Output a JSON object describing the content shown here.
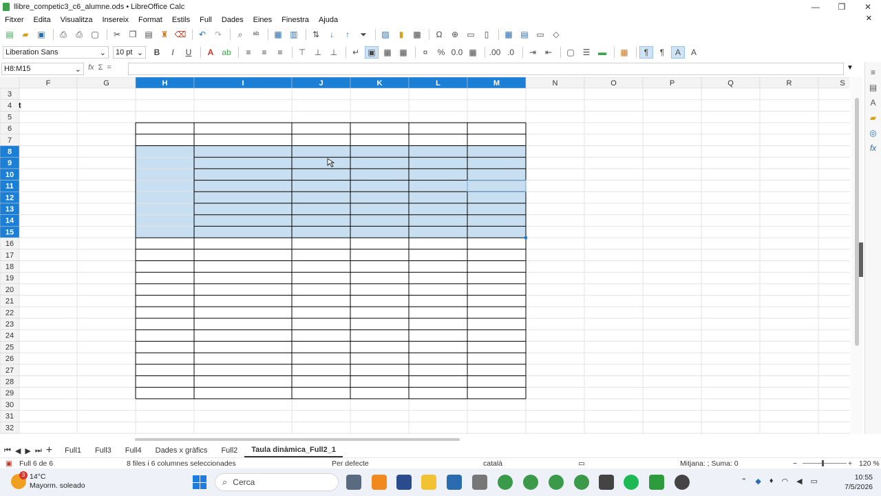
{
  "window": {
    "title": "llibre_competic3_c6_alumne.ods • LibreOffice Calc",
    "minimize": "—",
    "maximize": "❐",
    "close": "✕"
  },
  "menu": [
    "Fitxer",
    "Edita",
    "Visualitza",
    "Insereix",
    "Format",
    "Estils",
    "Full",
    "Dades",
    "Eines",
    "Finestra",
    "Ajuda"
  ],
  "font_box": {
    "name": "Liberation Sans",
    "size": "10 pt"
  },
  "formula_bar": {
    "cell_ref": "H8:M15",
    "value": ""
  },
  "grid": {
    "columns": [
      "F",
      "G",
      "H",
      "I",
      "J",
      "K",
      "L",
      "M",
      "N",
      "O",
      "P",
      "Q",
      "R",
      "S"
    ],
    "selected_columns": [
      "H",
      "I",
      "J",
      "K",
      "L",
      "M"
    ],
    "first_row": 3,
    "last_row": 32,
    "selected_rows": [
      8,
      9,
      10,
      11,
      12,
      13,
      14,
      15
    ],
    "table_rows": [
      6,
      29
    ],
    "cell_F4": "t",
    "colors": {
      "selection": "#c8dff1",
      "header_selected": "#1c7fd6",
      "header": "#f3f3f3",
      "border": "#000000"
    }
  },
  "sheet_tabs": [
    "Full1",
    "Full3",
    "Full4",
    "Dades x gràfics",
    "Full2",
    "Taula dinàmica_Full2_1"
  ],
  "active_tab": "Taula dinàmica_Full2_1",
  "status": {
    "sheet": "Full 6 de 6",
    "selection": "8 files i 6 columnes seleccionades",
    "style": "Per defecte",
    "language": "català",
    "sum": "Mitjana: ; Suma: 0",
    "zoom": "120 %"
  },
  "taskbar": {
    "temperature": "14°C",
    "weather": "Mayorm. soleado",
    "notification_count": "3",
    "search_placeholder": "Cerca",
    "time": "10:55",
    "date": "7/5/2026"
  }
}
